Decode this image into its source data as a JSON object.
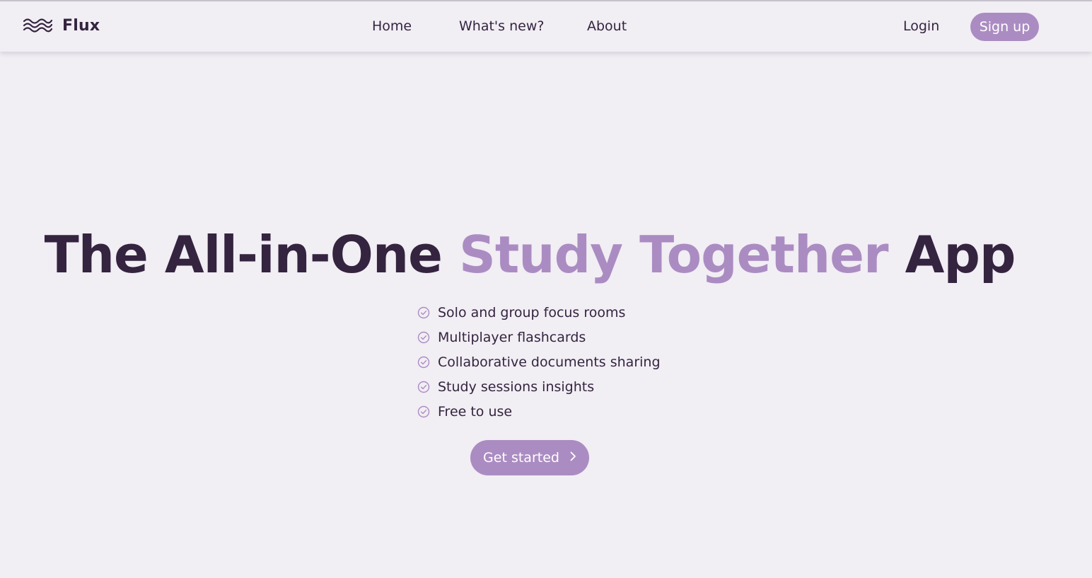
{
  "colors": {
    "background": "#f1eef4",
    "text_dark": "#34243f",
    "accent": "#ab8cc2",
    "button_text": "#ffffff"
  },
  "brand": {
    "name": "Flux",
    "icon": "waves-icon"
  },
  "nav": {
    "links": [
      {
        "label": "Home"
      },
      {
        "label": "What's new?"
      },
      {
        "label": "About"
      }
    ],
    "login_label": "Login",
    "signup_label": "Sign up"
  },
  "hero": {
    "title_before": "The All-in-One",
    "title_accent": "Study Together",
    "title_after": "App",
    "features": [
      {
        "label": "Solo and group focus rooms",
        "icon": "check-circle-icon"
      },
      {
        "label": "Multiplayer flashcards",
        "icon": "check-circle-icon"
      },
      {
        "label": "Collaborative documents sharing",
        "icon": "check-circle-icon"
      },
      {
        "label": "Study sessions insights",
        "icon": "check-circle-icon"
      },
      {
        "label": "Free to use",
        "icon": "check-circle-icon"
      }
    ],
    "cta_label": "Get started",
    "cta_icon": "chevron-right-icon"
  }
}
